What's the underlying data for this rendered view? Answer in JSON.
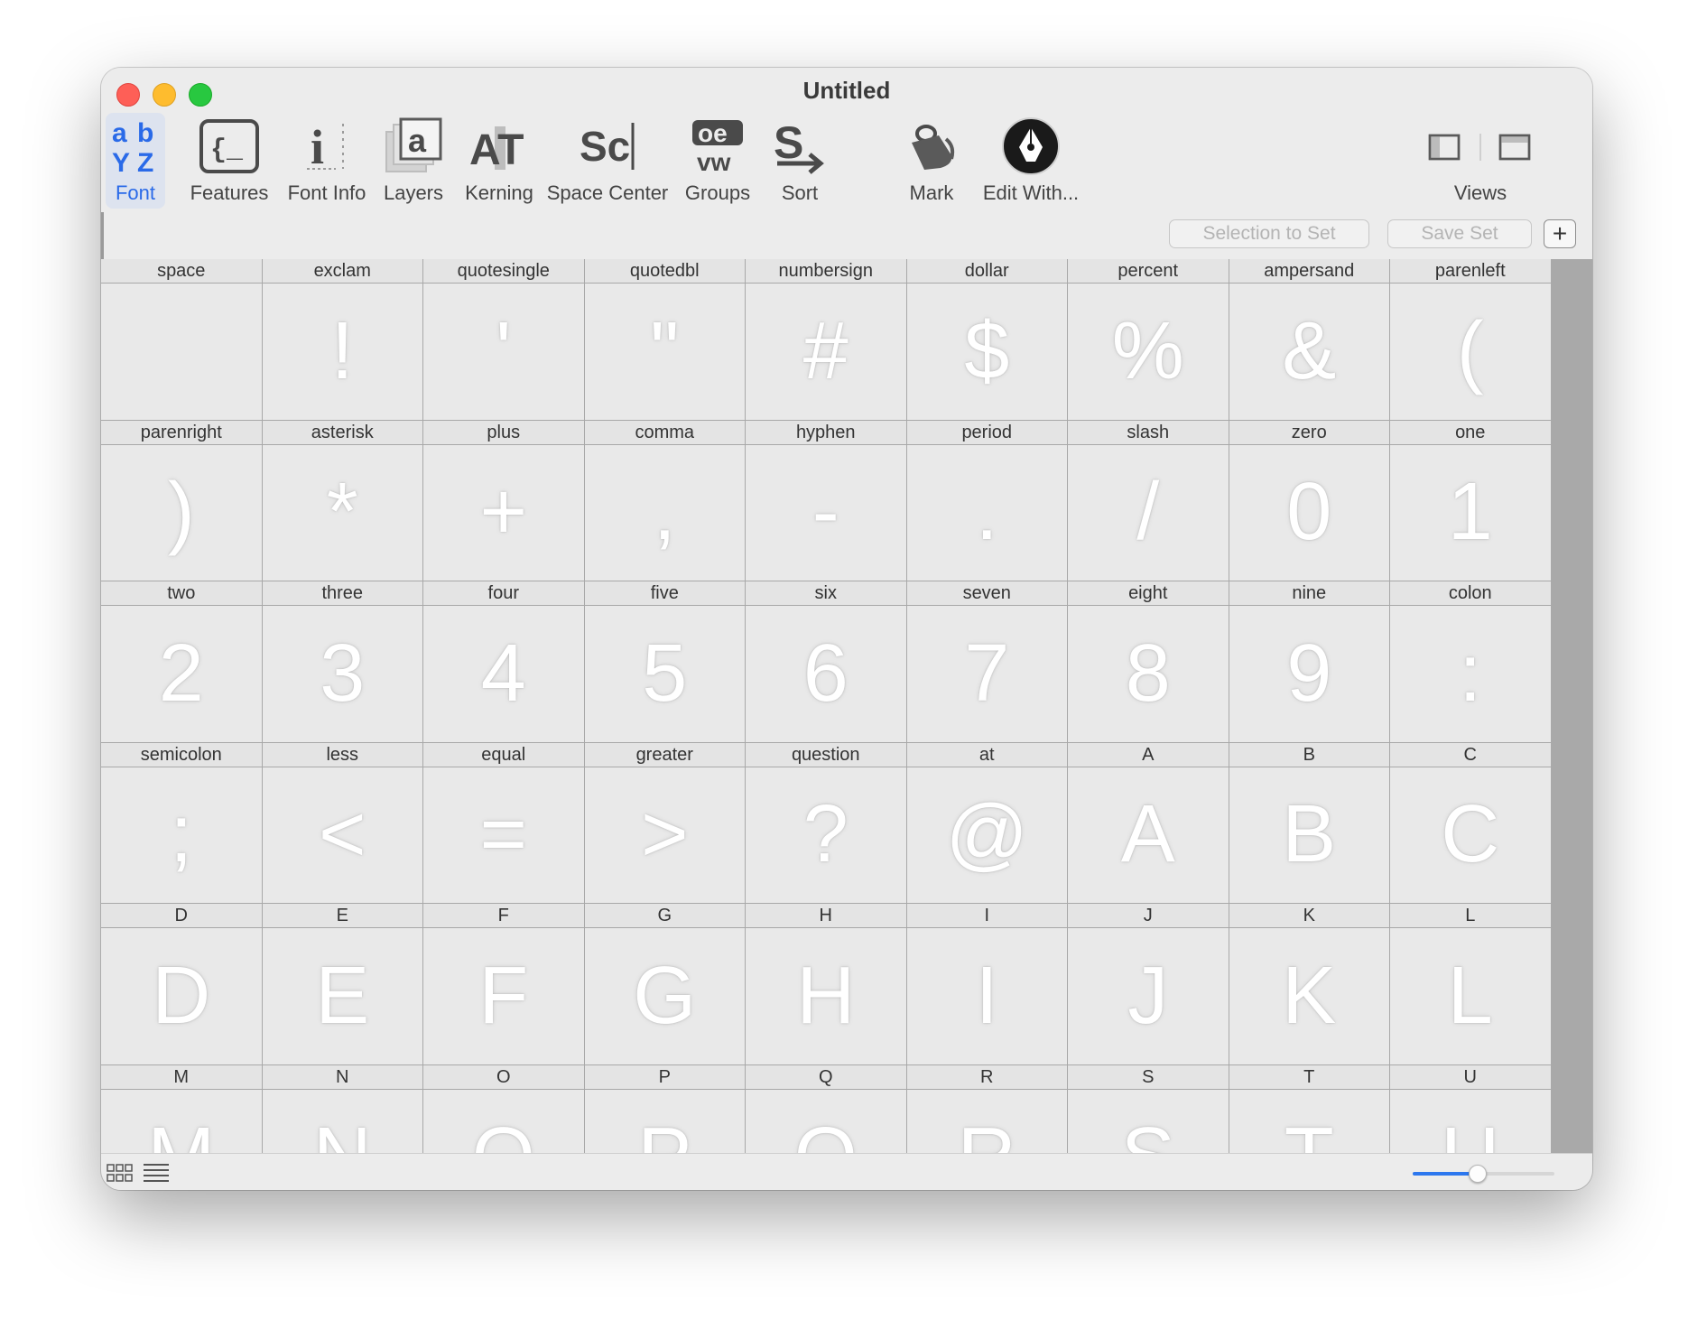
{
  "window": {
    "title": "Untitled"
  },
  "toolbar": {
    "items": [
      {
        "label": "Font",
        "icon": "font-abyz-icon",
        "active": true
      },
      {
        "label": "Features",
        "icon": "features-braces-icon"
      },
      {
        "label": "Font Info",
        "icon": "font-info-icon"
      },
      {
        "label": "Layers",
        "icon": "layers-icon"
      },
      {
        "label": "Kerning",
        "icon": "kerning-icon"
      },
      {
        "label": "Space Center",
        "icon": "space-center-icon"
      },
      {
        "label": "Groups",
        "icon": "groups-icon"
      },
      {
        "label": "Sort",
        "icon": "sort-icon"
      },
      {
        "label": "Mark",
        "icon": "paint-bucket-icon"
      },
      {
        "label": "Edit With...",
        "icon": "pen-nib-icon"
      },
      {
        "label": "Views",
        "icon": "views-icon"
      }
    ]
  },
  "setbar": {
    "selection_to_set": "Selection to Set",
    "save_set": "Save Set",
    "add": "+"
  },
  "glyphs": [
    {
      "name": "space",
      "char": ""
    },
    {
      "name": "exclam",
      "char": "!"
    },
    {
      "name": "quotesingle",
      "char": "'"
    },
    {
      "name": "quotedbl",
      "char": "\""
    },
    {
      "name": "numbersign",
      "char": "#"
    },
    {
      "name": "dollar",
      "char": "$"
    },
    {
      "name": "percent",
      "char": "%"
    },
    {
      "name": "ampersand",
      "char": "&"
    },
    {
      "name": "parenleft",
      "char": "("
    },
    {
      "name": "parenright",
      "char": ")"
    },
    {
      "name": "asterisk",
      "char": "*"
    },
    {
      "name": "plus",
      "char": "+"
    },
    {
      "name": "comma",
      "char": ","
    },
    {
      "name": "hyphen",
      "char": "-"
    },
    {
      "name": "period",
      "char": "."
    },
    {
      "name": "slash",
      "char": "/"
    },
    {
      "name": "zero",
      "char": "0"
    },
    {
      "name": "one",
      "char": "1"
    },
    {
      "name": "two",
      "char": "2"
    },
    {
      "name": "three",
      "char": "3"
    },
    {
      "name": "four",
      "char": "4"
    },
    {
      "name": "five",
      "char": "5"
    },
    {
      "name": "six",
      "char": "6"
    },
    {
      "name": "seven",
      "char": "7"
    },
    {
      "name": "eight",
      "char": "8"
    },
    {
      "name": "nine",
      "char": "9"
    },
    {
      "name": "colon",
      "char": ":"
    },
    {
      "name": "semicolon",
      "char": ";"
    },
    {
      "name": "less",
      "char": "<"
    },
    {
      "name": "equal",
      "char": "="
    },
    {
      "name": "greater",
      "char": ">"
    },
    {
      "name": "question",
      "char": "?"
    },
    {
      "name": "at",
      "char": "@"
    },
    {
      "name": "A",
      "char": "A"
    },
    {
      "name": "B",
      "char": "B"
    },
    {
      "name": "C",
      "char": "C"
    },
    {
      "name": "D",
      "char": "D"
    },
    {
      "name": "E",
      "char": "E"
    },
    {
      "name": "F",
      "char": "F"
    },
    {
      "name": "G",
      "char": "G"
    },
    {
      "name": "H",
      "char": "H"
    },
    {
      "name": "I",
      "char": "I"
    },
    {
      "name": "J",
      "char": "J"
    },
    {
      "name": "K",
      "char": "K"
    },
    {
      "name": "L",
      "char": "L"
    },
    {
      "name": "M",
      "char": "M"
    },
    {
      "name": "N",
      "char": "N"
    },
    {
      "name": "O",
      "char": "O"
    },
    {
      "name": "P",
      "char": "P"
    },
    {
      "name": "Q",
      "char": "Q"
    },
    {
      "name": "R",
      "char": "R"
    },
    {
      "name": "S",
      "char": "S"
    },
    {
      "name": "T",
      "char": "T"
    },
    {
      "name": "U",
      "char": "U"
    }
  ],
  "footer": {
    "left_icons": [
      "grid-view-icon",
      "list-view-icon"
    ],
    "zoom_level": 0.45
  },
  "colors": {
    "accent": "#2c77ee",
    "active_label": "#2a6ae8"
  }
}
